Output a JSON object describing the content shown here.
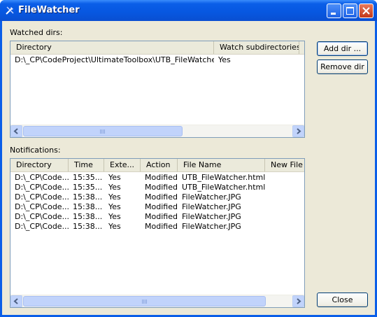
{
  "window": {
    "title": "FileWatcher"
  },
  "watched": {
    "label": "Watched dirs:",
    "columns": [
      "Directory",
      "Watch subdirectories"
    ],
    "rows": [
      {
        "directory": "D:\\_CP\\CodeProject\\UltimateToolbox\\UTB_FileWatcher",
        "watch": "Yes"
      }
    ],
    "add_button": "Add dir ...",
    "remove_button": "Remove dir"
  },
  "notifications": {
    "label": "Notifications:",
    "columns": [
      "Directory",
      "Time",
      "Exte...",
      "Action",
      "File Name",
      "New File I"
    ],
    "rows": [
      {
        "dir": "D:\\_CP\\Code...",
        "time": "15:35...",
        "ext": "Yes",
        "action": "Modified",
        "file": "UTB_FileWatcher.html"
      },
      {
        "dir": "D:\\_CP\\Code...",
        "time": "15:35...",
        "ext": "Yes",
        "action": "Modified",
        "file": "UTB_FileWatcher.html"
      },
      {
        "dir": "D:\\_CP\\Code...",
        "time": "15:38...",
        "ext": "Yes",
        "action": "Modified",
        "file": "FileWatcher.JPG"
      },
      {
        "dir": "D:\\_CP\\Code...",
        "time": "15:38...",
        "ext": "Yes",
        "action": "Modified",
        "file": "FileWatcher.JPG"
      },
      {
        "dir": "D:\\_CP\\Code...",
        "time": "15:38...",
        "ext": "Yes",
        "action": "Modified",
        "file": "FileWatcher.JPG"
      },
      {
        "dir": "D:\\_CP\\Code...",
        "time": "15:38...",
        "ext": "Yes",
        "action": "Modified",
        "file": "FileWatcher.JPG"
      }
    ],
    "close_button": "Close"
  },
  "icons": {
    "app": "tools-icon",
    "minimize": "minimize-icon",
    "maximize": "maximize-icon",
    "close": "close-icon",
    "scroll_left": "arrow-left-icon",
    "scroll_right": "arrow-right-icon"
  },
  "colors": {
    "titlebar": "#0a5ee8",
    "dialog": "#ece9d8",
    "border": "#7f9db9",
    "close": "#c2381a"
  }
}
